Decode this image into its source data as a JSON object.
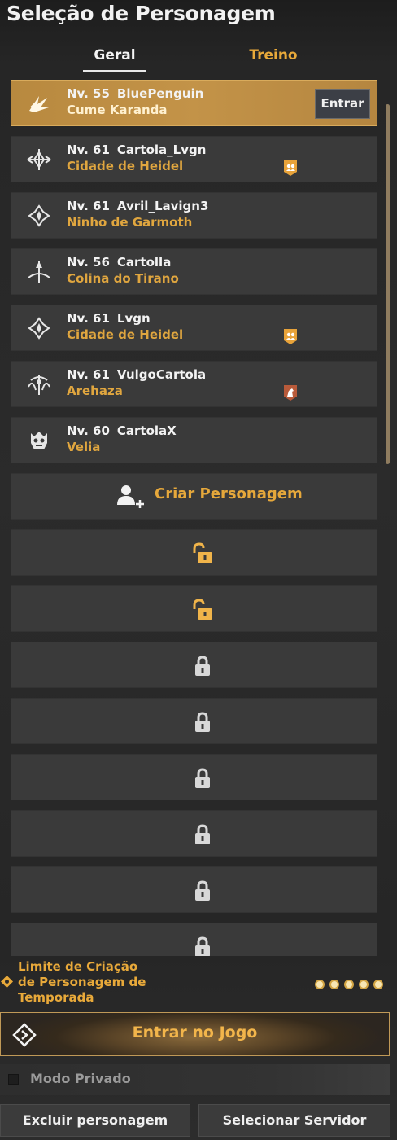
{
  "header": {
    "title": "Seleção de Personagem"
  },
  "tabs": [
    {
      "label": "Geral",
      "active": true
    },
    {
      "label": "Treino",
      "active": false
    }
  ],
  "characters": [
    {
      "level": "Nv. 55",
      "name": "BluePenguin",
      "location": "Cume Karanda",
      "selected": true,
      "enter_label": "Entrar",
      "badge": ""
    },
    {
      "level": "Nv. 61",
      "name": "Cartola_Lvgn",
      "location": "Cidade de Heidel",
      "selected": false,
      "badge": "group-badge-icon"
    },
    {
      "level": "Nv. 61",
      "name": "Avril_Lavign3",
      "location": "Ninho de Garmoth",
      "selected": false,
      "badge": ""
    },
    {
      "level": "Nv. 56",
      "name": "Cartolla",
      "location": "Colina do Tirano",
      "selected": false,
      "badge": ""
    },
    {
      "level": "Nv. 61",
      "name": "Lvgn",
      "location": "Cidade de Heidel",
      "selected": false,
      "badge": "group-badge-icon"
    },
    {
      "level": "Nv. 61",
      "name": "VulgoCartola",
      "location": "Arehaza",
      "selected": false,
      "badge": "horse-badge-icon"
    },
    {
      "level": "Nv. 60",
      "name": "CartolaX",
      "location": "Velia",
      "selected": false,
      "badge": ""
    }
  ],
  "create": {
    "label": "Criar Personagem"
  },
  "slots": [
    {
      "state": "unlocked"
    },
    {
      "state": "unlocked"
    },
    {
      "state": "locked"
    },
    {
      "state": "locked"
    },
    {
      "state": "locked"
    },
    {
      "state": "locked"
    },
    {
      "state": "locked"
    },
    {
      "state": "locked"
    }
  ],
  "season_limit": {
    "label": "Limite de Criação de Personagem de Temporada",
    "remaining": 5,
    "total": 5
  },
  "play_button": {
    "label": "Entrar no Jogo"
  },
  "private_mode": {
    "label": "Modo Privado",
    "checked": false
  },
  "buttons": {
    "delete_label": "Excluir personagem",
    "server_label": "Selecionar Servidor"
  },
  "colors": {
    "accent": "#e8a93a",
    "selected_slot": "#c39348",
    "slot": "#3a3a3a",
    "lock_unlocked": "#f0b44a",
    "lock_locked": "#d8d8d8"
  }
}
